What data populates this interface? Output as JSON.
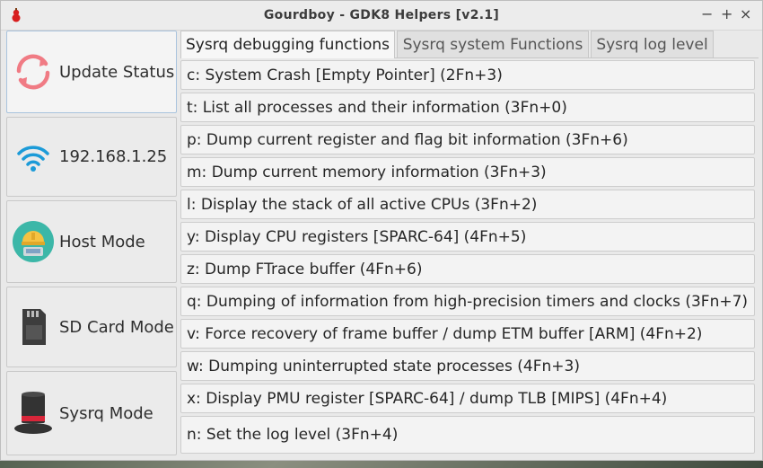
{
  "window": {
    "title": "Gourdboy - GDK8 Helpers [v2.1]",
    "controls": {
      "minimize": "−",
      "maximize": "+",
      "close": "×"
    }
  },
  "sidebar": {
    "items": [
      {
        "label": "Update Status",
        "icon": "refresh-icon"
      },
      {
        "label": "192.168.1.25",
        "icon": "wifi-icon"
      },
      {
        "label": "Host Mode",
        "icon": "host-mode-icon"
      },
      {
        "label": "SD Card Mode",
        "icon": "sd-card-icon"
      },
      {
        "label": "Sysrq Mode",
        "icon": "top-hat-icon"
      }
    ]
  },
  "tabs": [
    {
      "label": "Sysrq debugging functions",
      "active": true
    },
    {
      "label": "Sysrq system Functions",
      "active": false
    },
    {
      "label": "Sysrq log level",
      "active": false
    }
  ],
  "functions": [
    "c: System Crash [Empty Pointer] (2Fn+3)",
    "t: List all processes and their information (3Fn+0)",
    "p: Dump current register and flag bit information (3Fn+6)",
    "m: Dump current memory information (3Fn+3)",
    "l: Display the stack of all active CPUs (3Fn+2)",
    "y: Display CPU registers [SPARC-64] (4Fn+5)",
    "z: Dump FTrace buffer (4Fn+6)",
    "q: Dumping of information from high-precision timers and clocks (3Fn+7)",
    "v: Force recovery of frame buffer / dump ETM buffer [ARM] (4Fn+2)",
    "w: Dumping uninterrupted state processes (4Fn+3)",
    "x: Display PMU register [SPARC-64] / dump TLB [MIPS] (4Fn+4)",
    "n: Set the log level (3Fn+4)"
  ],
  "colors": {
    "accent_border": "#a9c3dd",
    "refresh": "#f07b84",
    "wifi": "#1c9bd8",
    "host": "#3cb7a8",
    "hat_band": "#d8263a"
  }
}
